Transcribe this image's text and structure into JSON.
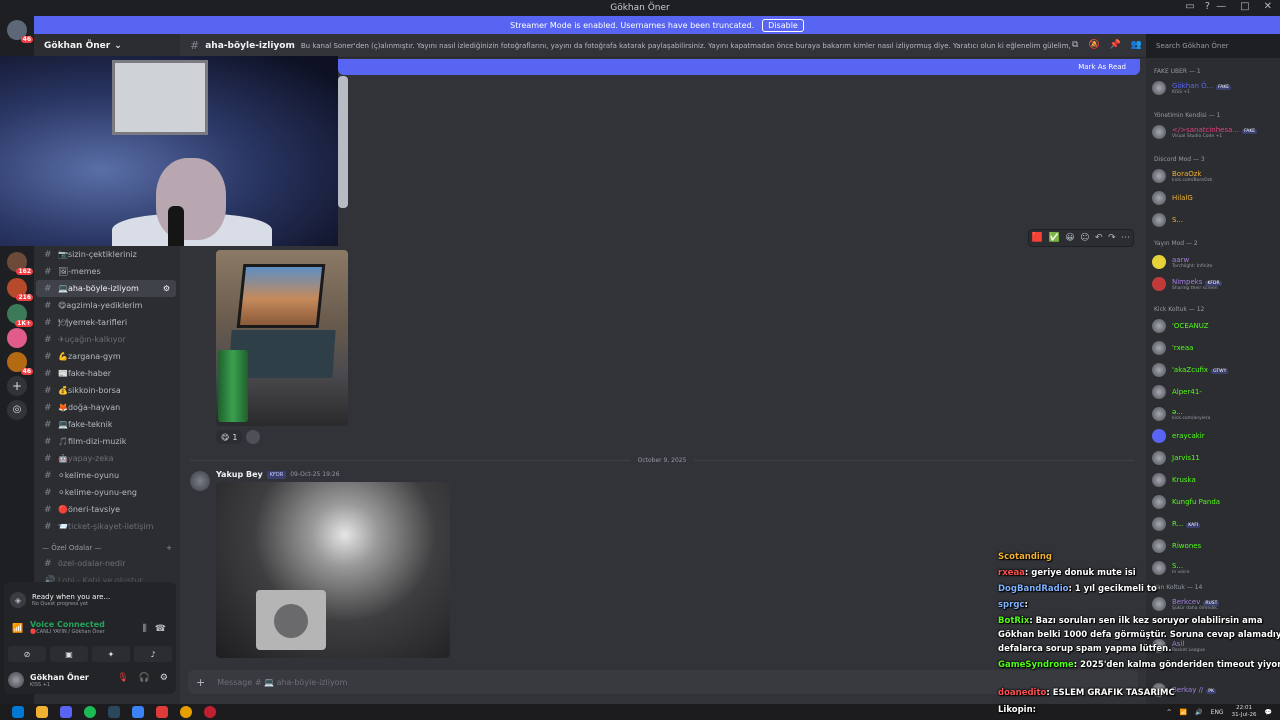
{
  "window": {
    "title": "Gökhan Öner"
  },
  "banner": {
    "text": "Streamer Mode is enabled. Usernames have been truncated.",
    "button": "Disable"
  },
  "server": {
    "name": "Gökhan Öner"
  },
  "channel_header": {
    "name": "aha-böyle-izliyom",
    "topic": "Bu kanal Soner'den (ç)alınmıştır. Yayını nasıl izlediğinizin fotoğraflarını, yayını da fotoğrafa katarak paylaşabilirsiniz. Yayını kapatmadan önce buraya bakarım kimler nasıl izliyormuş diye. Yaratıcı olun ki eğlenelim gülelim, sıradan olmayın... Kanal Cooldown'ı 10 ..."
  },
  "search": {
    "placeholder": "Search Gökhan Öner"
  },
  "new_messages_bar": {
    "left_text": "ö",
    "action": "Mark As Read"
  },
  "rail_badges": [
    "46",
    "162",
    "216",
    "1K+",
    "46"
  ],
  "channels": [
    {
      "label": "📷sizin-çektikleriniz",
      "state": "normal"
    },
    {
      "label": "🖼-memes",
      "state": "normal"
    },
    {
      "label": "💻aha-böyle-izliyom",
      "state": "active"
    },
    {
      "label": "😋agzimla-yediklerim",
      "state": "normal"
    },
    {
      "label": "🍽yemek-tarifleri",
      "state": "normal"
    },
    {
      "label": "✈uçağın-kalkıyor",
      "state": "muted"
    },
    {
      "label": "💪zargana-gym",
      "state": "normal"
    },
    {
      "label": "📰fake-haber",
      "state": "normal"
    },
    {
      "label": "💰sikkoin-borsa",
      "state": "normal"
    },
    {
      "label": "🦊doğa-hayvan",
      "state": "normal"
    },
    {
      "label": "💻fake-teknik",
      "state": "normal"
    },
    {
      "label": "🎵film-dizi-muzik",
      "state": "normal"
    },
    {
      "label": "🤖yapay-zeka",
      "state": "muted"
    },
    {
      "label": "⚪kelime-oyunu",
      "state": "normal"
    },
    {
      "label": "⚪kelime-oyunu-eng",
      "state": "normal"
    },
    {
      "label": "🔴öneri-tavsiye",
      "state": "normal"
    },
    {
      "label": "📨ticket-şikayet-iletişim",
      "state": "muted"
    }
  ],
  "category": {
    "label": "— Özel Odalar —",
    "add": "+"
  },
  "private_channels": [
    "özel-odalar-nedir",
    "Lobi - Katıl ve oluştur"
  ],
  "messages": [
    {
      "reactions": [
        {
          "emoji": "😋",
          "count": "1"
        }
      ]
    },
    {
      "author": "Yakup Bey",
      "tag": "KFDR",
      "time": "09-Oct-25 19:26"
    }
  ],
  "date_separator": "October 9, 2025",
  "composer": {
    "placeholder": "Message # 💻 aha-böyle-izliyom"
  },
  "user_panel": {
    "quest_title": "Ready when you are...",
    "quest_sub": "No Quest progress yet",
    "voice_title": "Voice Connected",
    "voice_sub": "🔴CANLI YAYIN / Gökhan Öner",
    "me_name": "Gökhan Öner",
    "me_status": "KISS +1"
  },
  "members": {
    "groups": [
      {
        "label": "FAKE UBER — 1"
      },
      {
        "label": "Yönetimin Kendisi — 1"
      },
      {
        "label": "Discord Mod — 3"
      },
      {
        "label": "Yayın Mod — 2"
      },
      {
        "label": "Kick Koltuk — 12"
      },
      {
        "label": "Yan Koltuk — 14"
      }
    ],
    "rows": [
      {
        "name": "Gökhan Ö...",
        "status": "KISS +1",
        "badge": "FAKE"
      },
      {
        "name": "</>sanatcinhesa...",
        "status": "Visual Studio Code +1",
        "badge": "FAKE"
      },
      {
        "name": "BoraOzk",
        "status": "kick.com/BoraOzk",
        "badge": ""
      },
      {
        "name": "HilalG",
        "status": "",
        "badge": ""
      },
      {
        "name": "S...",
        "status": "",
        "badge": ""
      },
      {
        "name": "aarw",
        "status": "Torchlight: Infinite",
        "badge": ""
      },
      {
        "name": "Nimpeks",
        "status": "Sharing their screen",
        "badge": "KFDR"
      },
      {
        "name": "'OCEANUZ",
        "status": "",
        "badge": ""
      },
      {
        "name": "'rxeaa",
        "status": "",
        "badge": ""
      },
      {
        "name": "'akaZcufix",
        "status": "",
        "badge": "GTWY"
      },
      {
        "name": "Alper41-",
        "status": "",
        "badge": ""
      },
      {
        "name": "ə...",
        "status": "kick.com/anyiera",
        "badge": ""
      },
      {
        "name": "eraycakir",
        "status": "",
        "badge": ""
      },
      {
        "name": "Jarvis11",
        "status": "",
        "badge": ""
      },
      {
        "name": "Kruska",
        "status": "",
        "badge": ""
      },
      {
        "name": "Kungfu Panda",
        "status": "",
        "badge": ""
      },
      {
        "name": "R...",
        "status": "",
        "badge": "KAFI"
      },
      {
        "name": "Riwones",
        "status": "",
        "badge": ""
      },
      {
        "name": "S...",
        "status": "In voice",
        "badge": ""
      },
      {
        "name": "Berkcev",
        "status": "Şükür daha ölmedik.",
        "badge": "RUST"
      },
      {
        "name": "Asil",
        "status": "Rocket League",
        "badge": ""
      },
      {
        "name": "Berkay //",
        "status": "",
        "badge": "PK"
      }
    ]
  },
  "chat_overlay": [
    {
      "user": "Scotanding",
      "text": ""
    },
    {
      "user": "rxeaa",
      "text": ": geriye donuk mute isi"
    },
    {
      "user": "DogBandRadio",
      "text": ": 1 yıl gecikmeli to"
    },
    {
      "user": "sprgc",
      "text": ":"
    },
    {
      "user": "BotRix",
      "text": ": Bazı soruları sen ilk kez soruyor olabilirsin ama"
    },
    {
      "user": "",
      "text": "Gökhan belki 1000 defa görmüştür. Soruna cevap alamadıysan"
    },
    {
      "user": "",
      "text": "defalarca sorup spam yapma lütfen."
    },
    {
      "user": "GameSyndrome",
      "text": ": 2025'den kalma gönderiden timeout yiyorlar"
    },
    {
      "user": "doanedito",
      "text": ": ESLEM GRAFIK TASARIMC"
    },
    {
      "user": "Likopin",
      "text": ":"
    }
  ],
  "tray": {
    "lang": "ENG",
    "time": "22:01",
    "date": "31-Jul-26"
  },
  "colors": {
    "accent": "#5865f2",
    "online": "#23a55a",
    "danger": "#f23f43",
    "kick": "#53fc18"
  }
}
